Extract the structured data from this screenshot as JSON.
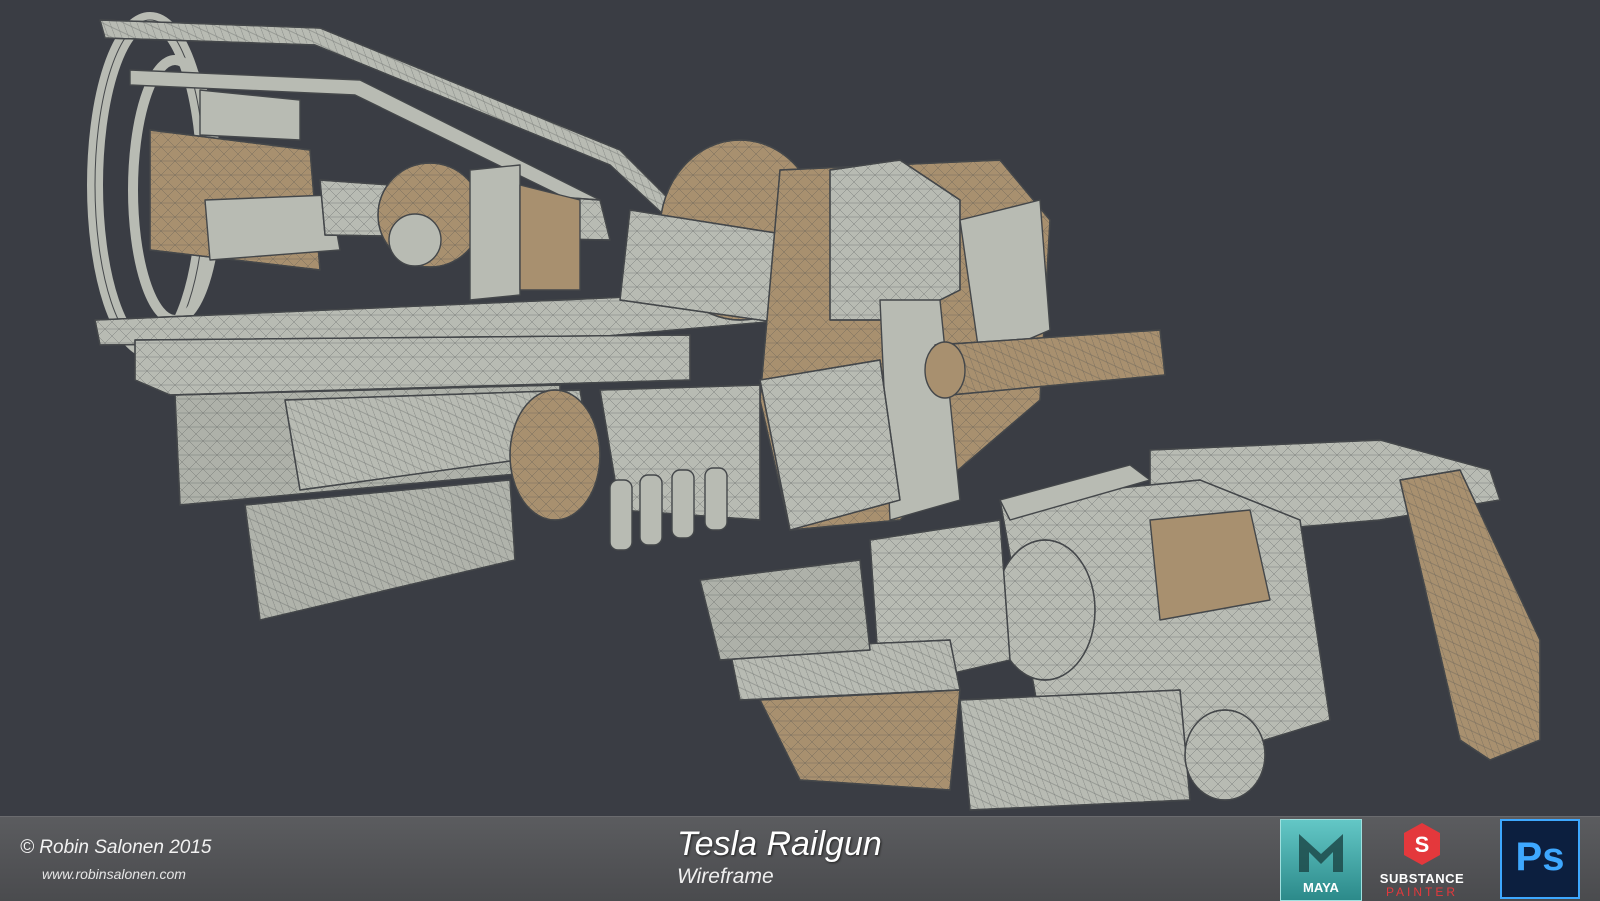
{
  "footer": {
    "copyright": "© Robin Salonen 2015",
    "website": "www.robinsalonen.com",
    "title": "Tesla Railgun",
    "subtitle": "Wireframe",
    "logos": {
      "maya": "MAYA",
      "substance": "SUBSTANCE",
      "substance_sub": "PAINTER",
      "photoshop": "Ps"
    }
  },
  "colors": {
    "background": "#3a3d44",
    "mesh_gray": "#b8bbb3",
    "mesh_tan": "#a8906f",
    "wire": "#44474a"
  }
}
